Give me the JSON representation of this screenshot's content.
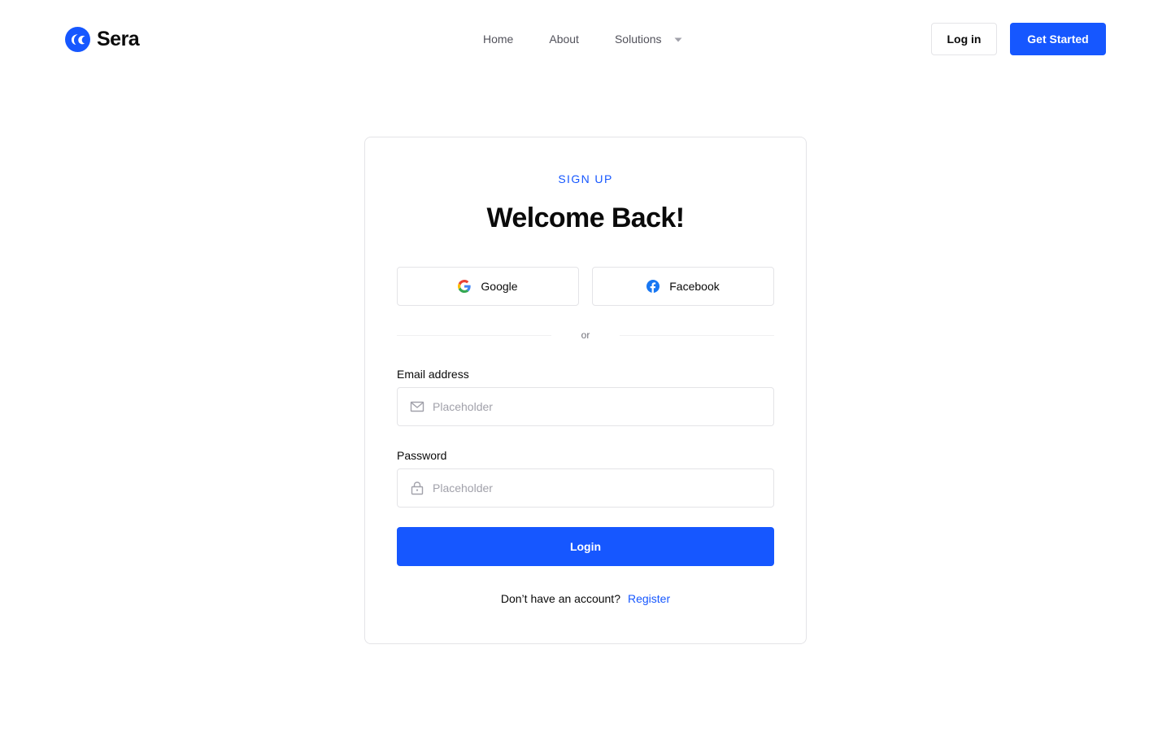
{
  "brand": {
    "name": "Sera",
    "logo_icon": "sera-logo-icon"
  },
  "nav": {
    "items": [
      {
        "label": "Home"
      },
      {
        "label": "About"
      },
      {
        "label": "Solutions",
        "icon": "chevron-down-icon"
      }
    ]
  },
  "header_actions": {
    "login_label": "Log in",
    "get_started_label": "Get Started"
  },
  "card": {
    "eyebrow": "SIGN UP",
    "title": "Welcome Back!",
    "social": {
      "google_label": "Google",
      "google_icon": "google-icon",
      "facebook_label": "Facebook",
      "facebook_icon": "facebook-icon"
    },
    "divider_text": "or",
    "email": {
      "label": "Email address",
      "placeholder": "Placeholder",
      "value": "",
      "icon": "mail-icon"
    },
    "password": {
      "label": "Password",
      "placeholder": "Placeholder",
      "value": "",
      "icon": "lock-icon"
    },
    "submit_label": "Login",
    "footer": {
      "prompt": "Don’t have an account?",
      "link_label": "Register"
    }
  },
  "colors": {
    "accent": "#1657FF",
    "text": "#0A0A0A",
    "muted": "#52525B",
    "border": "#E4E4E7",
    "placeholder": "#A1A1AA"
  }
}
